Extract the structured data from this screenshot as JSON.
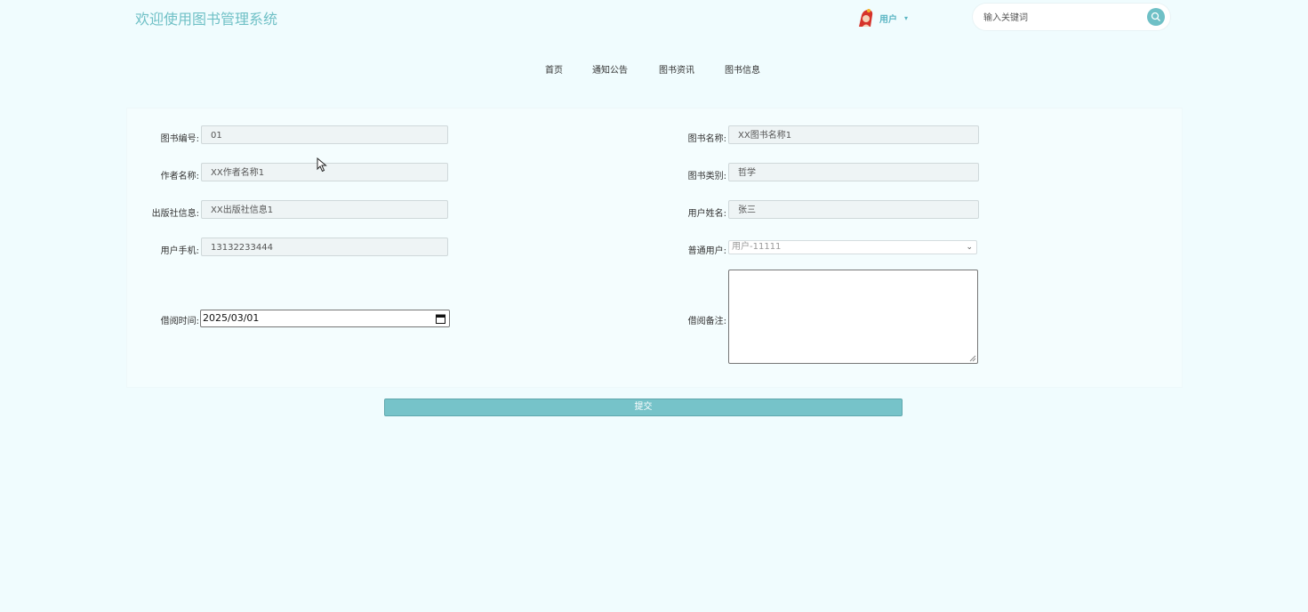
{
  "header": {
    "site_title": "欢迎使用图书管理系统",
    "user_label": "用户",
    "user_caret": "▾",
    "search_placeholder": "输入关键词"
  },
  "nav": {
    "items": [
      {
        "label": "首页"
      },
      {
        "label": "通知公告"
      },
      {
        "label": "图书资讯"
      },
      {
        "label": "图书信息"
      }
    ]
  },
  "form": {
    "book_no": {
      "label": "图书编号:",
      "value": "01"
    },
    "book_name": {
      "label": "图书名称:",
      "value": "XX图书名称1"
    },
    "author": {
      "label": "作者名称:",
      "value": "XX作者名称1"
    },
    "category": {
      "label": "图书类别:",
      "value": "哲学"
    },
    "publisher": {
      "label": "出版社信息:",
      "value": "XX出版社信息1"
    },
    "user_name": {
      "label": "用户姓名:",
      "value": "张三"
    },
    "user_phone": {
      "label": "用户手机:",
      "value": "13132233444"
    },
    "normal_user": {
      "label": "普通用户:",
      "selected": "用户-11111"
    },
    "borrow_time": {
      "label": "借阅时间:",
      "value": "2025/03/01"
    },
    "borrow_note": {
      "label": "借阅备注:",
      "value": ""
    }
  },
  "submit_label": "提交",
  "colors": {
    "accent": "#6fc0c6",
    "button": "#76c3c9",
    "background": "#f0fcfe"
  }
}
